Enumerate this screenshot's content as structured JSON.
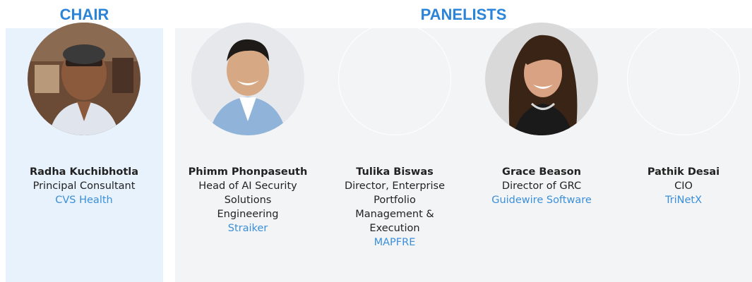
{
  "headings": {
    "chair": "CHAIR",
    "panelists": "PANELISTS"
  },
  "colors": {
    "accent": "#2b84d8",
    "link": "#3b8fd9",
    "chair_bg": "#e8f2fd",
    "panel_bg": "#f3f4f6"
  },
  "people": [
    {
      "name": "Radha Kuchibhotla",
      "title_lines": [
        "Principal Consultant"
      ],
      "org": "CVS Health",
      "photo": "radha-photo"
    },
    {
      "name": "Phimm Phonpaseuth",
      "title_lines": [
        "Head of AI Security",
        "Solutions",
        "Engineering"
      ],
      "org": "Straiker",
      "photo": "phimm-photo"
    },
    {
      "name": "Tulika Biswas",
      "title_lines": [
        "Director, Enterprise",
        "Portfolio",
        "Management &",
        "Execution"
      ],
      "org": "MAPFRE",
      "photo": "empty-photo"
    },
    {
      "name": "Grace Beason",
      "title_lines": [
        "Director of GRC"
      ],
      "org": "Guidewire Software",
      "photo": "grace-photo"
    },
    {
      "name": "Pathik Desai",
      "title_lines": [
        "CIO"
      ],
      "org": "TriNetX",
      "photo": "empty-photo"
    }
  ]
}
